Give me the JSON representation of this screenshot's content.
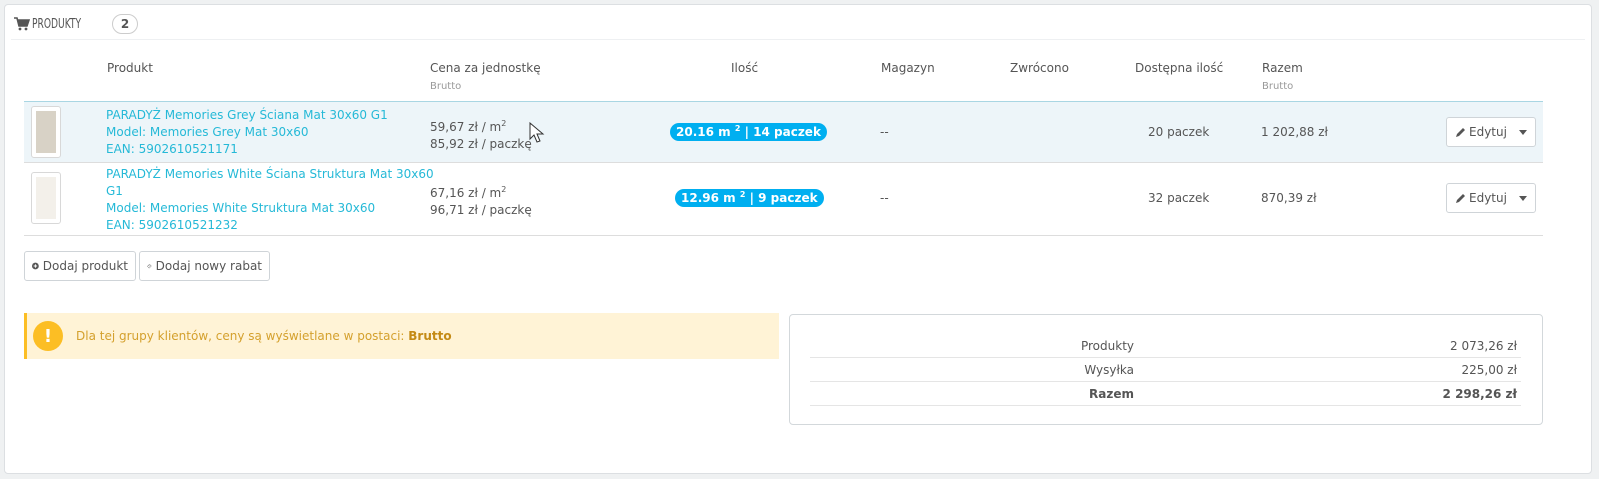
{
  "panel": {
    "title": "PRODUKTY",
    "count": "2"
  },
  "columns": {
    "product": "Produkt",
    "unit_price": "Cena za jednostkę",
    "unit_price_sub": "Brutto",
    "quantity": "Ilość",
    "warehouse": "Magazyn",
    "returned": "Zwrócono",
    "available": "Dostępna ilość",
    "total": "Razem",
    "total_sub": "Brutto"
  },
  "rows": [
    {
      "name": "PARADYŻ Memories Grey Ściana Mat 30x60 G1",
      "model": "Model: Memories Grey Mat 30x60",
      "ean": "EAN: 5902610521171",
      "price_m2": "59,67 zł / m",
      "price_m2_sup": "2",
      "price_pack": "85,92 zł / paczkę",
      "qty_m2": "20.16 m ",
      "qty_sup": "2",
      "qty_packs": " | 14 paczek",
      "warehouse": "--",
      "available": "20 paczek",
      "total": "1 202,88 zł",
      "edit_label": "Edytuj",
      "thumb_color": "#d8d2c6"
    },
    {
      "name_line1": "PARADYŻ Memories White Ściana Struktura Mat 30x60",
      "name_line2": "G1",
      "model": "Model: Memories White Struktura Mat 30x60",
      "ean": "EAN: 5902610521232",
      "price_m2": "67,16 zł / m",
      "price_m2_sup": "2",
      "price_pack": "96,71 zł / paczkę",
      "qty_m2": "12.96 m ",
      "qty_sup": "2",
      "qty_packs": " | 9 paczek",
      "warehouse": "--",
      "available": "32 paczek",
      "total": "870,39 zł",
      "edit_label": "Edytuj",
      "thumb_color": "#f3f0ea"
    }
  ],
  "buttons": {
    "add_product": "Dodaj produkt",
    "add_discount": "Dodaj nowy rabat"
  },
  "alert": {
    "icon": "!",
    "text": "Dla tej grupy klientów, ceny są wyświetlane w postaci: ",
    "bold": "Brutto"
  },
  "summary": [
    {
      "label": "Produkty",
      "value": "2 073,26 zł"
    },
    {
      "label": "Wysyłka",
      "value": "225,00 zł"
    },
    {
      "label": "Razem",
      "value": "2 298,26 zł"
    }
  ],
  "colors": {
    "link": "#25b9d7",
    "badge": "#00aff0",
    "warning": "#fcbe24"
  }
}
